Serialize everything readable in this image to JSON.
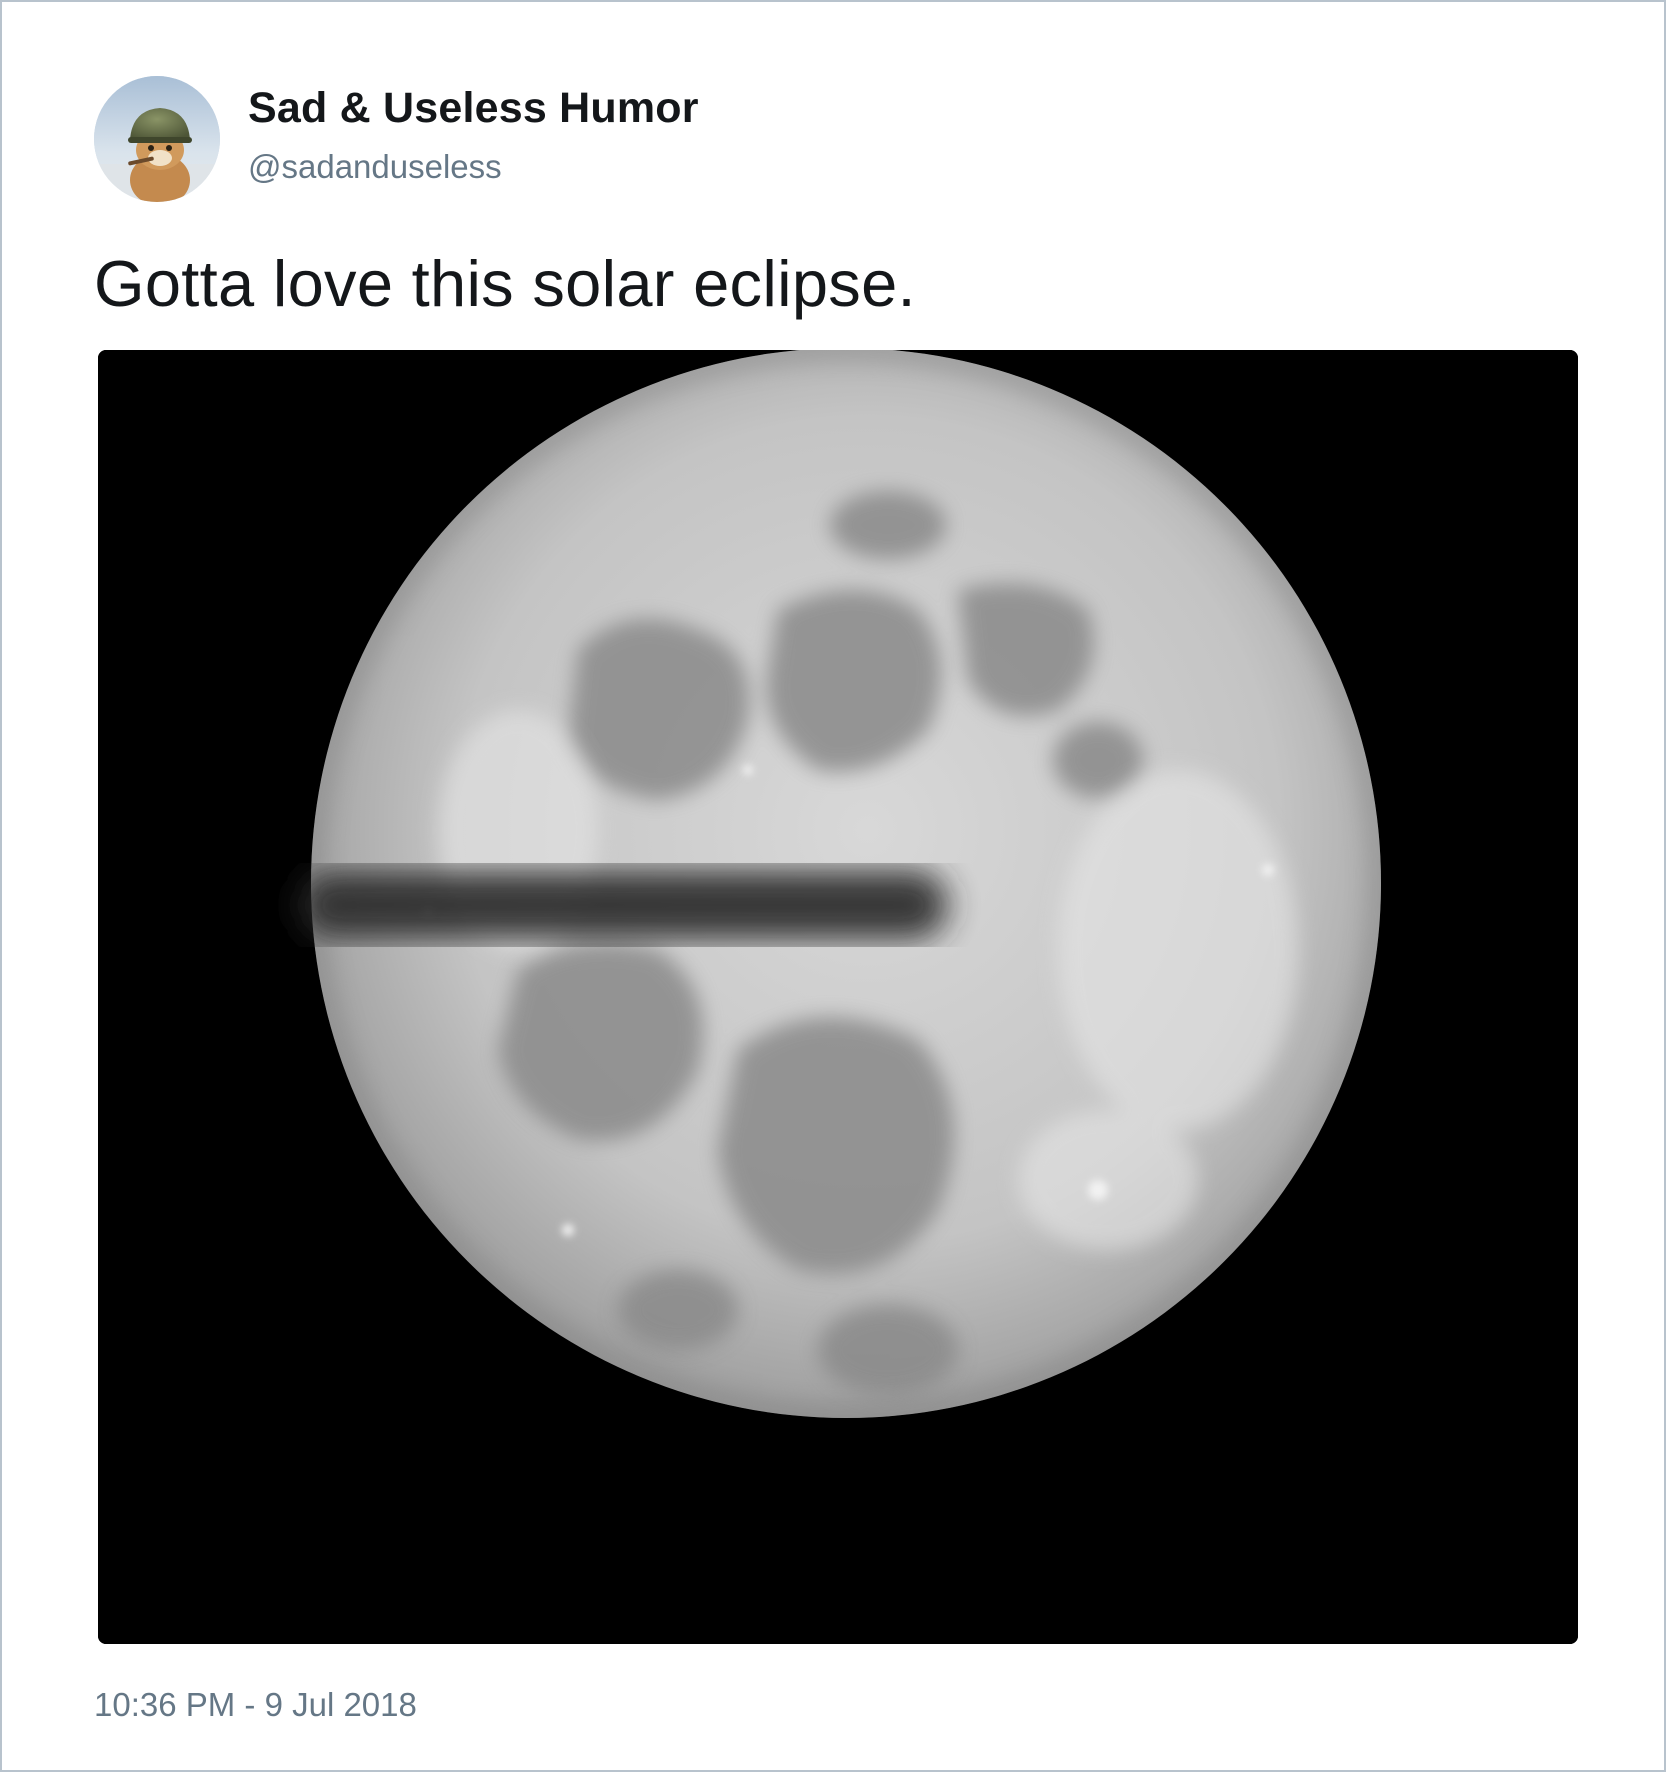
{
  "tweet": {
    "author": {
      "display_name": "Sad & Useless Humor",
      "handle": "@sadanduseless"
    },
    "text": "Gotta love this solar eclipse.",
    "media": {
      "kind": "photo",
      "subject": "full-moon-with-dark-horizontal-bar"
    },
    "timestamp": "10:36 PM - 9 Jul 2018"
  },
  "colors": {
    "border": "#b8c3cd",
    "name_text": "#14171a",
    "secondary_text": "#657786",
    "media_background": "#000000"
  },
  "icons": {
    "avatar": "helmet-cat-avatar"
  }
}
